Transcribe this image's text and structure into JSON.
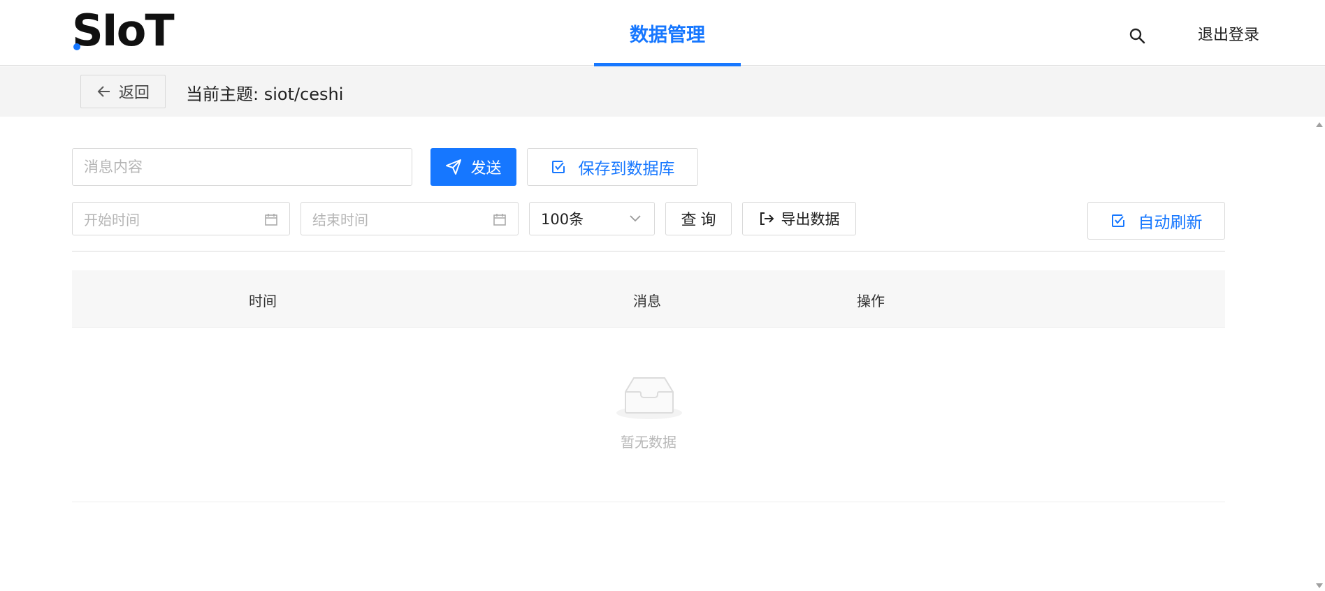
{
  "header": {
    "logo": "SIoT",
    "nav_tab": "数据管理",
    "search_icon": "search-icon",
    "logout": "退出登录"
  },
  "subheader": {
    "back_label": "返回",
    "topic": "当前主题: siot/ceshi"
  },
  "form": {
    "message_placeholder": "消息内容",
    "send_label": "发送",
    "save_label": "保存到数据库",
    "save_checked": true,
    "start_placeholder": "开始时间",
    "end_placeholder": "结束时间",
    "limit_value": "100条",
    "query_label": "查 询",
    "export_label": "导出数据",
    "refresh_label": "自动刷新",
    "refresh_checked": true
  },
  "table": {
    "columns": [
      "时间",
      "消息",
      "操作"
    ],
    "rows": [],
    "empty_text": "暂无数据"
  },
  "colors": {
    "accent": "#1677ff"
  }
}
